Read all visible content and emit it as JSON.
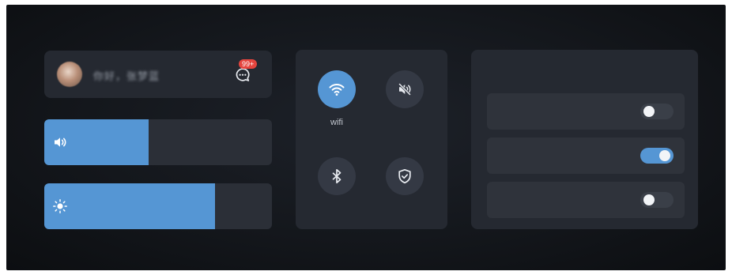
{
  "user": {
    "name": "你好，张梦蓝",
    "notification_badge": "99+"
  },
  "sliders": {
    "volume": {
      "level_percent": 46
    },
    "brightness": {
      "level_percent": 75
    }
  },
  "quick_settings": {
    "wifi": {
      "label": "wifi",
      "enabled": true,
      "icon": "wifi-icon"
    },
    "mute": {
      "enabled": false,
      "icon": "speaker-muted-icon"
    },
    "bluetooth": {
      "enabled": false,
      "icon": "bluetooth-icon"
    },
    "security": {
      "enabled": false,
      "icon": "shield-check-icon"
    }
  },
  "settings": {
    "toggles": [
      {
        "enabled": false
      },
      {
        "enabled": true
      },
      {
        "enabled": false
      }
    ]
  },
  "colors": {
    "accent": "#5596d4",
    "badge": "#e5453e",
    "card": "#252931",
    "background": "#14171c"
  }
}
